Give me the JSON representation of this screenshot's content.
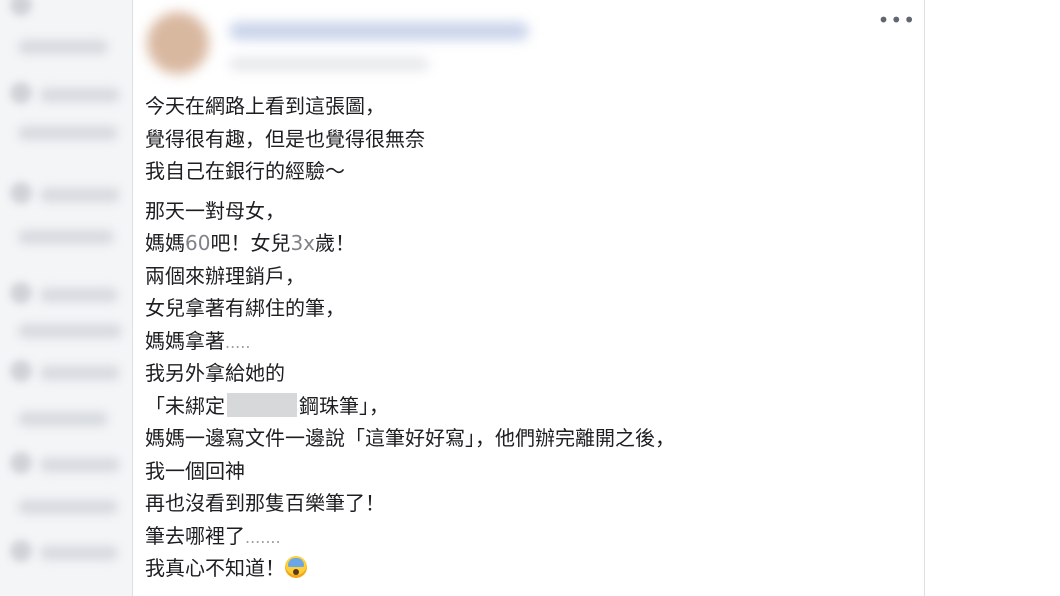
{
  "post": {
    "more_options_icon": "more-horizontal-icon",
    "lines": [
      "今天在網路上看到這張圖，",
      "覺得很有趣，但是也覺得很無奈",
      "我自己在銀行的經驗～"
    ],
    "lines2": [
      "那天一對母女，",
      {
        "a": "媽媽",
        "b": "60",
        "c": "吧！女兒",
        "d": "3x",
        "e": "歲！"
      },
      "兩個來辦理銷戶，",
      "女兒拿著有綁住的筆，",
      {
        "a": "媽媽拿著",
        "dots": "....."
      },
      "我另外拿給她的",
      {
        "a": "「未綁定",
        "b": "鋼珠筆」，"
      },
      "媽媽一邊寫文件一邊說「這筆好好寫」，他們辦完離開之後，",
      "我一個回神",
      "再也沒看到那隻百樂筆了！",
      {
        "a": "筆去哪裡了",
        "dots": "......."
      },
      {
        "a": "我真心不知道！",
        "emoji": "screaming-face-icon"
      }
    ]
  }
}
